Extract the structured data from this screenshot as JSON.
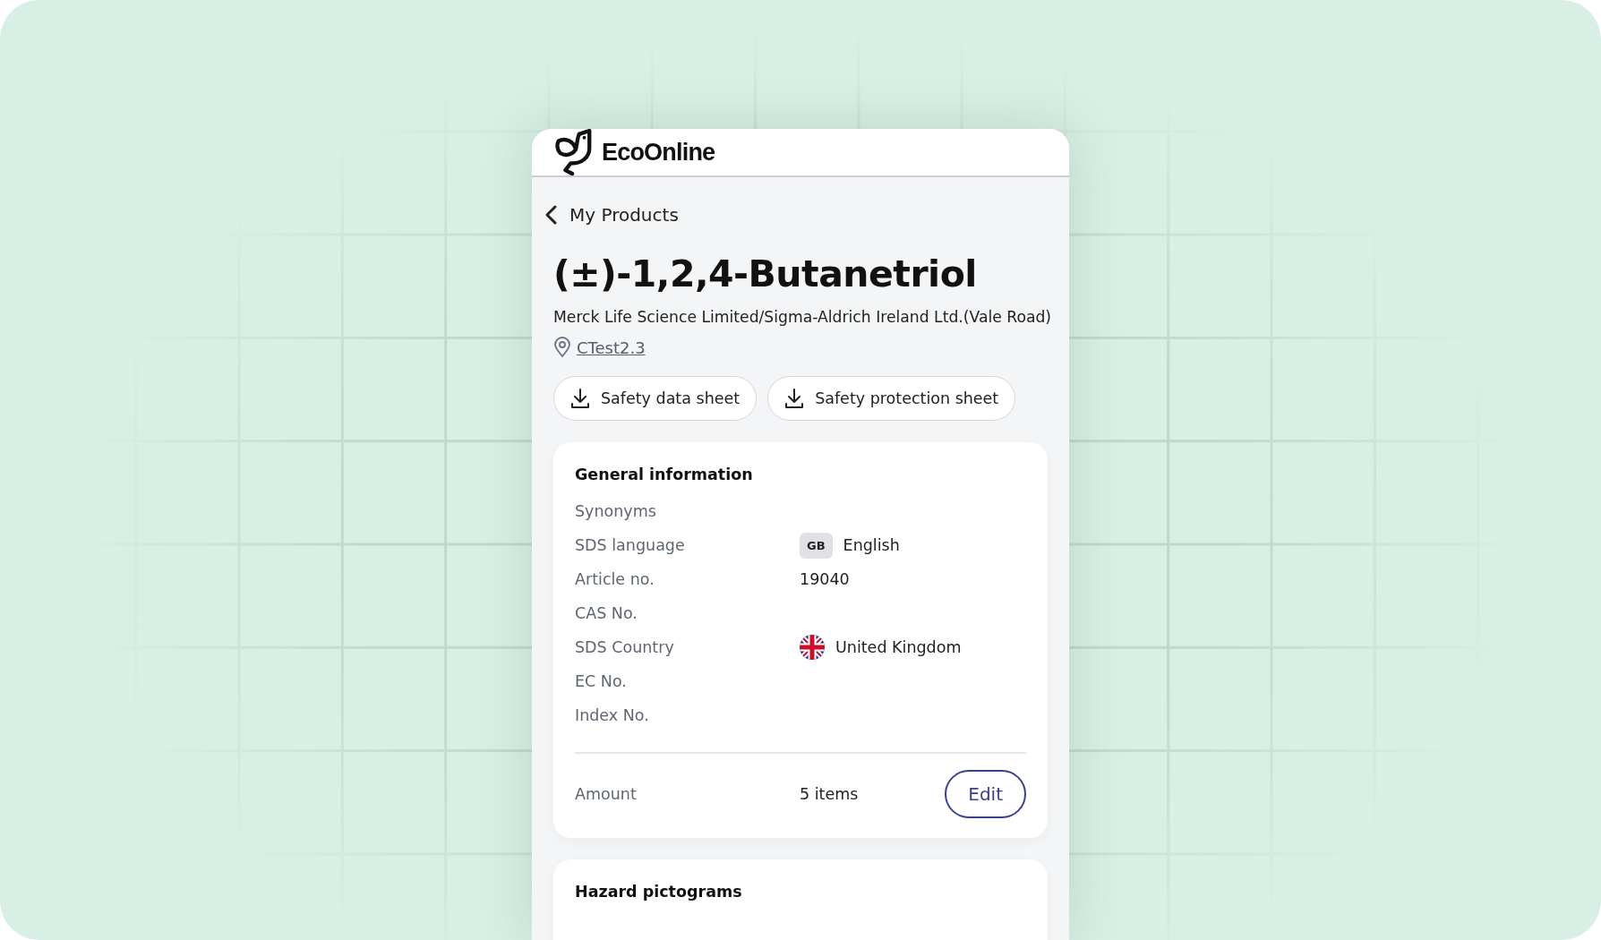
{
  "brand": {
    "name": "EcoOnline"
  },
  "back_link": {
    "label": "My Products"
  },
  "product": {
    "name": "(±)-1,2,4-Butanetriol",
    "supplier": "Merck Life Science Limited/Sigma-Aldrich Ireland Ltd.(Vale Road)",
    "location": "CTest2.3"
  },
  "downloads": [
    "Safety data sheet",
    "Safety protection sheet"
  ],
  "general_information": {
    "title": "General information",
    "rows": [
      {
        "kind": "plain",
        "label": "Synonyms"
      },
      {
        "kind": "language",
        "label": "SDS language",
        "badge": "GB",
        "value": "English"
      },
      {
        "kind": "plain",
        "label": "Article no.",
        "value": "19040"
      },
      {
        "kind": "plain",
        "label": "CAS No."
      },
      {
        "kind": "country",
        "label": "SDS Country",
        "value": "United Kingdom"
      },
      {
        "kind": "plain",
        "label": "EC No."
      },
      {
        "kind": "plain",
        "label": "Index No."
      }
    ],
    "amount": {
      "label": "Amount",
      "value": "5 items",
      "button": "Edit"
    }
  },
  "hazard_pictograms": {
    "title": "Hazard pictograms"
  }
}
